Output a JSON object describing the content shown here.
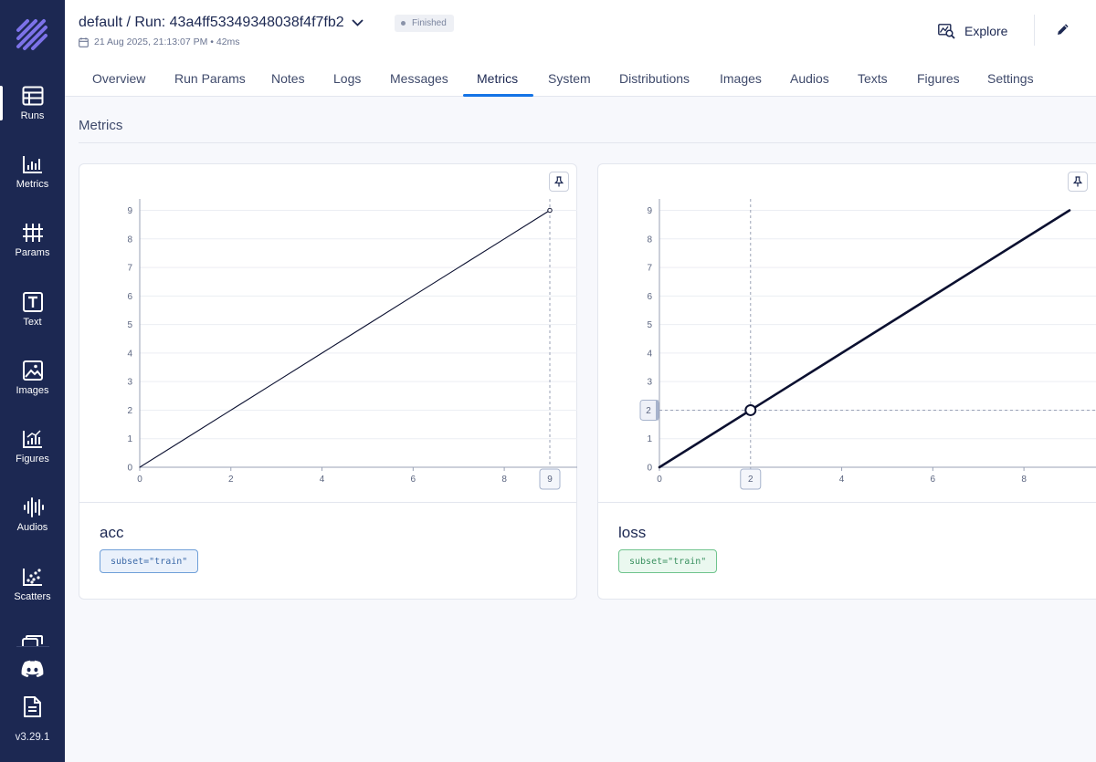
{
  "sidebar": {
    "items": [
      {
        "label": "Runs",
        "icon": "table-icon"
      },
      {
        "label": "Metrics",
        "icon": "metrics-chart-icon"
      },
      {
        "label": "Params",
        "icon": "params-icon"
      },
      {
        "label": "Text",
        "icon": "text-icon"
      },
      {
        "label": "Images",
        "icon": "image-icon"
      },
      {
        "label": "Figures",
        "icon": "figures-icon"
      },
      {
        "label": "Audios",
        "icon": "audio-waveform-icon"
      },
      {
        "label": "Scatters",
        "icon": "scatter-icon"
      }
    ],
    "active": "Runs",
    "version": "v3.29.1"
  },
  "header": {
    "experiment": "default",
    "run_label": "Run:",
    "run_hash": "43a4ff53349348038f4f7fb2",
    "status": "Finished",
    "datetime": "21 Aug 2025, 21:13:07 PM",
    "duration": "42ms",
    "explore_label": "Explore"
  },
  "tabs": [
    "Overview",
    "Run Params",
    "Notes",
    "Logs",
    "Messages",
    "Metrics",
    "System",
    "Distributions",
    "Images",
    "Audios",
    "Texts",
    "Figures",
    "Settings"
  ],
  "active_tab": "Metrics",
  "section_title": "Metrics",
  "metrics": [
    {
      "name": "acc",
      "context": "subset=\"train\"",
      "chip_color": "#3c6aa8"
    },
    {
      "name": "loss",
      "context": "subset=\"train\"",
      "chip_color": "#3a9160"
    }
  ],
  "chart_data": [
    {
      "type": "line",
      "x": [
        0,
        1,
        2,
        3,
        4,
        5,
        6,
        7,
        8,
        9
      ],
      "series": [
        {
          "name": "acc",
          "values": [
            0,
            1,
            2,
            3,
            4,
            5,
            6,
            7,
            8,
            9
          ]
        }
      ],
      "xticks": [
        0,
        2,
        4,
        6,
        8
      ],
      "yticks": [
        0,
        1,
        2,
        3,
        4,
        5,
        6,
        7,
        8,
        9
      ],
      "xlim": [
        0,
        9
      ],
      "ylim": [
        0,
        9.4
      ],
      "hover": {
        "x": 9,
        "y": 9,
        "x_label": "9"
      },
      "line_color": "#0b1030",
      "grid": true
    },
    {
      "type": "line",
      "x": [
        0,
        1,
        2,
        3,
        4,
        5,
        6,
        7,
        8,
        9
      ],
      "series": [
        {
          "name": "loss",
          "values": [
            0,
            1,
            2,
            3,
            4,
            5,
            6,
            7,
            8,
            9
          ]
        }
      ],
      "xticks": [
        0,
        2,
        4,
        6,
        8
      ],
      "yticks": [
        0,
        1,
        2,
        3,
        4,
        5,
        6,
        7,
        8,
        9
      ],
      "xlim": [
        0,
        9
      ],
      "ylim": [
        0,
        9.4
      ],
      "hover": {
        "x": 2,
        "y": 2,
        "x_label": "2",
        "y_label": "2"
      },
      "line_color": "#0b1030",
      "grid": true
    }
  ]
}
